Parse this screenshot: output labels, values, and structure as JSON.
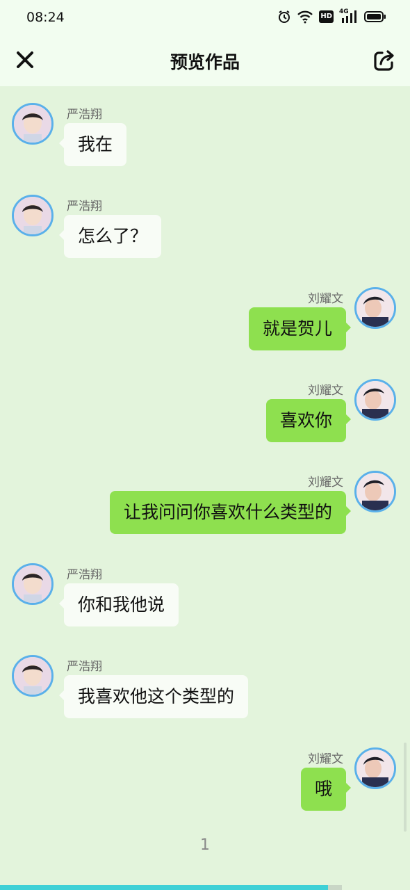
{
  "status_bar": {
    "time": "08:24",
    "icons": [
      "alarm-icon",
      "wifi-icon",
      "hd-icon",
      "signal-4g-icon",
      "battery-icon"
    ],
    "network_label": "4G",
    "hd_label": "HD"
  },
  "header": {
    "title": "预览作品",
    "close_icon": "close-icon",
    "share_icon": "share-icon"
  },
  "messages": [
    {
      "side": "left",
      "sender": "严浩翔",
      "text": "我在"
    },
    {
      "side": "left",
      "sender": "严浩翔",
      "text": "怎么了？"
    },
    {
      "side": "right",
      "sender": "刘耀文",
      "text": "就是贺儿"
    },
    {
      "side": "right",
      "sender": "刘耀文",
      "text": "喜欢你"
    },
    {
      "side": "right",
      "sender": "刘耀文",
      "text": "让我问问你喜欢什么类型的"
    },
    {
      "side": "left",
      "sender": "严浩翔",
      "text": "你和我他说"
    },
    {
      "side": "left",
      "sender": "严浩翔",
      "text": "我喜欢他这个类型的"
    },
    {
      "side": "right",
      "sender": "刘耀文",
      "text": "哦"
    }
  ],
  "footer": {
    "page_number": "1",
    "progress_fraction": 0.96
  },
  "colors": {
    "background": "#e3f4dc",
    "header": "#f2fdf0",
    "bubble_left": "#f8fcf6",
    "bubble_right": "#8ee04f",
    "avatar_ring": "#5ab0ea",
    "progress": "#3ed0d6"
  }
}
